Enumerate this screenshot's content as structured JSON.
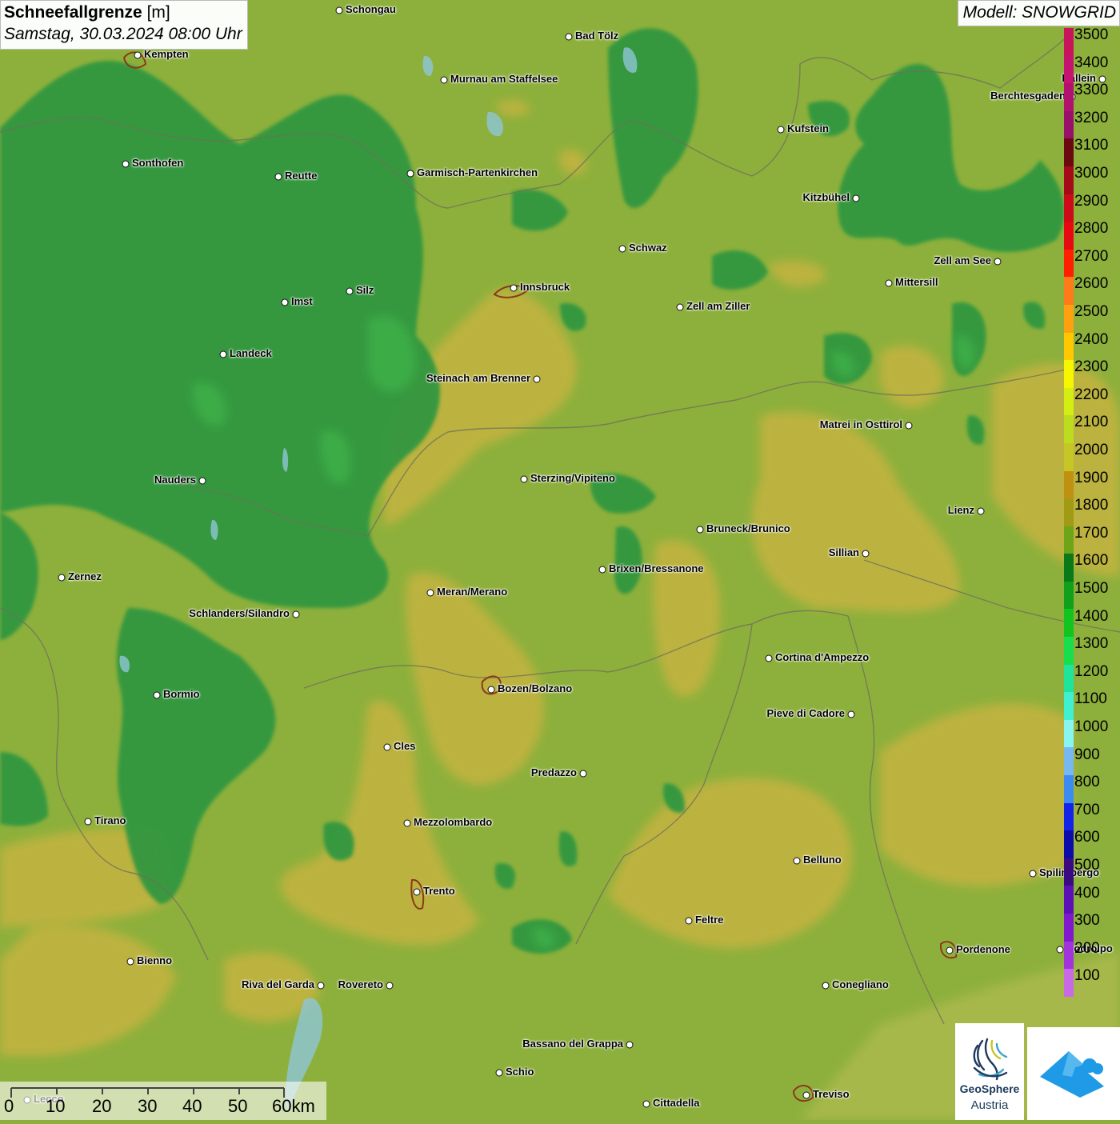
{
  "header": {
    "title_bold": "Schneefallgrenze",
    "title_unit": " [m]",
    "datetime": "Samstag, 30.03.2024 08:00 Uhr",
    "model": "Modell: SNOWGRID"
  },
  "legend": {
    "labels": [
      "3500",
      "3400",
      "3300",
      "3200",
      "3100",
      "3000",
      "2900",
      "2800",
      "2700",
      "2600",
      "2500",
      "2400",
      "2300",
      "2200",
      "2100",
      "2000",
      "1900",
      "1800",
      "1700",
      "1600",
      "1500",
      "1400",
      "1300",
      "1200",
      "1100",
      "1000",
      "900",
      "800",
      "700",
      "600",
      "500",
      "400",
      "300",
      "200",
      "100"
    ],
    "colors": [
      "#c8145a",
      "#c41470",
      "#b0126e",
      "#98106a",
      "#6a0a10",
      "#a40a18",
      "#cc0a18",
      "#e60a10",
      "#ff1e00",
      "#ff7a18",
      "#ffa010",
      "#ffc800",
      "#f6f600",
      "#d2ee12",
      "#bcdc20",
      "#c6c626",
      "#c09010",
      "#a09a14",
      "#6ea418",
      "#0a7a18",
      "#10a01a",
      "#14c41e",
      "#18de4e",
      "#20e49a",
      "#40f0d0",
      "#88f6ef",
      "#78b8f2",
      "#3c8cf0",
      "#1424e6",
      "#0c0ca8",
      "#3a0a80",
      "#5a10b4",
      "#8018cc",
      "#a234dc",
      "#c86ae6"
    ]
  },
  "cities": [
    {
      "name": "Schongau",
      "label": "Schongau"
    },
    {
      "name": "bad-toelz",
      "label": "Bad Tölz"
    },
    {
      "name": "kempten",
      "label": "Kempten"
    },
    {
      "name": "murnau",
      "label": "Murnau am Staffelsee"
    },
    {
      "name": "hallein",
      "label": "Hallein"
    },
    {
      "name": "berchtesgaden",
      "label": "Berchtesgaden"
    },
    {
      "name": "kufstein",
      "label": "Kufstein"
    },
    {
      "name": "sonthofen",
      "label": "Sonthofen"
    },
    {
      "name": "reutte",
      "label": "Reutte"
    },
    {
      "name": "garmisch",
      "label": "Garmisch-Partenkirchen"
    },
    {
      "name": "kitzbuehel",
      "label": "Kitzbühel"
    },
    {
      "name": "schwaz",
      "label": "Schwaz"
    },
    {
      "name": "zell-am-see",
      "label": "Zell am See"
    },
    {
      "name": "innsbruck",
      "label": "Innsbruck"
    },
    {
      "name": "mittersill",
      "label": "Mittersill"
    },
    {
      "name": "imst",
      "label": "Imst"
    },
    {
      "name": "silz",
      "label": "Silz"
    },
    {
      "name": "zell-am-ziller",
      "label": "Zell am Ziller"
    },
    {
      "name": "landeck",
      "label": "Landeck"
    },
    {
      "name": "steinach",
      "label": "Steinach am Brenner"
    },
    {
      "name": "matrei",
      "label": "Matrei in Osttirol"
    },
    {
      "name": "nauders",
      "label": "Nauders"
    },
    {
      "name": "sterzing",
      "label": "Sterzing/Vipiteno"
    },
    {
      "name": "lienz",
      "label": "Lienz"
    },
    {
      "name": "bruneck",
      "label": "Bruneck/Brunico"
    },
    {
      "name": "sillian",
      "label": "Sillian"
    },
    {
      "name": "zernez",
      "label": "Zernez"
    },
    {
      "name": "brixen",
      "label": "Brixen/Bressanone"
    },
    {
      "name": "meran",
      "label": "Meran/Merano"
    },
    {
      "name": "schlanders",
      "label": "Schlanders/Silandro"
    },
    {
      "name": "cortina",
      "label": "Cortina d'Ampezzo"
    },
    {
      "name": "bozen",
      "label": "Bozen/Bolzano"
    },
    {
      "name": "bormio",
      "label": "Bormio"
    },
    {
      "name": "pieve",
      "label": "Pieve di Cadore"
    },
    {
      "name": "cles",
      "label": "Cles"
    },
    {
      "name": "predazzo",
      "label": "Predazzo"
    },
    {
      "name": "tirano",
      "label": "Tirano"
    },
    {
      "name": "mezzolombardo",
      "label": "Mezzolombardo"
    },
    {
      "name": "belluno",
      "label": "Belluno"
    },
    {
      "name": "spilimbergo",
      "label": "Spilimbergo"
    },
    {
      "name": "trento",
      "label": "Trento"
    },
    {
      "name": "feltre",
      "label": "Feltre"
    },
    {
      "name": "pordenone",
      "label": "Pordenone"
    },
    {
      "name": "codroipo",
      "label": "Codroipo"
    },
    {
      "name": "bienno",
      "label": "Bienno"
    },
    {
      "name": "riva",
      "label": "Riva del Garda"
    },
    {
      "name": "rovereto",
      "label": "Rovereto"
    },
    {
      "name": "conegliano",
      "label": "Conegliano"
    },
    {
      "name": "bassano",
      "label": "Bassano del Grappa"
    },
    {
      "name": "schio",
      "label": "Schio"
    },
    {
      "name": "treviso",
      "label": "Treviso"
    },
    {
      "name": "cittadella",
      "label": "Cittadella"
    },
    {
      "name": "lecco",
      "label": "Lecco"
    }
  ],
  "scale_bar": {
    "labels": [
      "0",
      "10",
      "20",
      "30",
      "40",
      "50",
      "60km"
    ]
  },
  "logos": {
    "geosphere_line1": "GeoSphere",
    "geosphere_line2": "Austria"
  },
  "colors": {
    "base_green": "#8fae3c",
    "dark_green": "#2f9a3e",
    "yellow_zone": "#c2b340"
  }
}
